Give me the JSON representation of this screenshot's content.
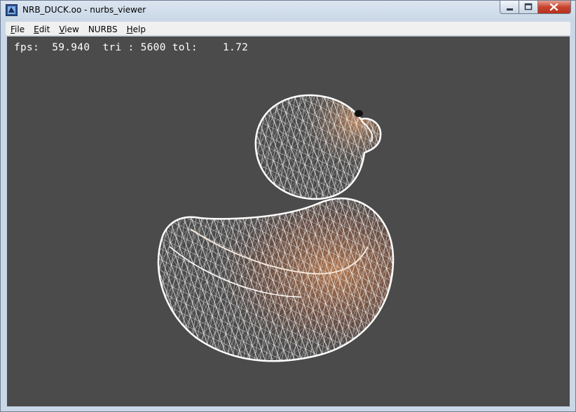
{
  "window": {
    "title": "NRB_DUCK.oo - nurbs_viewer",
    "controls": [
      "minimize-icon",
      "maximize-icon",
      "close-icon"
    ]
  },
  "menu": [
    {
      "accel": "F",
      "rest": "ile"
    },
    {
      "accel": "E",
      "rest": "dit"
    },
    {
      "accel": "V",
      "rest": "iew"
    },
    {
      "accel": "",
      "rest": "NURBS"
    },
    {
      "accel": "H",
      "rest": "elp"
    }
  ],
  "hud": {
    "fps_label": "fps:",
    "fps_value": "59.940",
    "tri_label": "tri :",
    "tri_value": "5600",
    "tol_label": "tol:",
    "tol_value": "1.72"
  },
  "viewport": {
    "background": "#4b4b4b",
    "model": "wireframe-duck-mesh"
  },
  "colors": {
    "wire": "#ffffff",
    "shade_warm": "#c9875a",
    "close_button": "#c7452f"
  }
}
